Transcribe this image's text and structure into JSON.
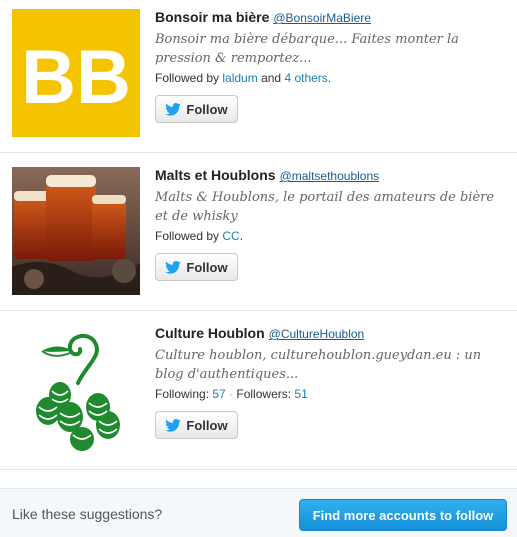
{
  "suggestions": [
    {
      "name": "Bonsoir ma bière",
      "handle": "@BonsoirMaBiere",
      "bio": "Bonsoir ma bière débarque... Faites monter la pression & remportez...",
      "meta_prefix": "Followed by ",
      "meta_link1": "laldum",
      "meta_mid": " and ",
      "meta_link2": "4 others",
      "meta_suffix": ".",
      "avatar_text": "BB",
      "avatar_color": "#f5c400",
      "follow_label": "Follow"
    },
    {
      "name": "Malts et Houblons",
      "handle": "@maltsethoublons",
      "bio": "Malts & Houblons, le portail des amateurs de bière et de whisky",
      "meta_prefix": "Followed by ",
      "meta_link1": "CC",
      "meta_suffix": ".",
      "follow_label": "Follow"
    },
    {
      "name": "Culture Houblon",
      "handle": "@CultureHoublon",
      "bio": "Culture houblon, culturehoublon.gueydan.eu : un blog d'authentiques...",
      "meta_following_label": "Following: ",
      "meta_following_count": "57",
      "meta_sep": " · ",
      "meta_followers_label": "Followers: ",
      "meta_followers_count": "51",
      "follow_label": "Follow"
    }
  ],
  "footer": {
    "prompt": "Like these suggestions?",
    "button_label": "Find more accounts to follow"
  },
  "colors": {
    "link": "#1a80b8",
    "brand_blue": "#1da1f2",
    "avatar_yellow": "#f5c400"
  }
}
